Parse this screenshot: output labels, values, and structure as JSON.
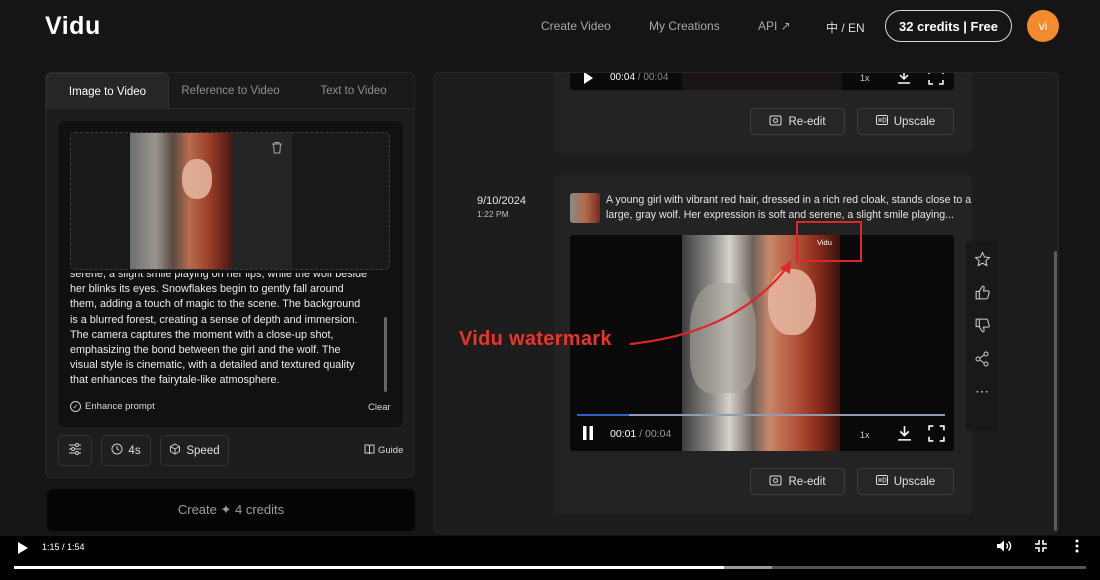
{
  "header": {
    "logo": "Vidu",
    "nav": [
      "Create Video",
      "My Creations",
      "API ↗"
    ],
    "lang": "中 / EN",
    "credits": "32 credits | Free",
    "avatar": "vi"
  },
  "left": {
    "tabs": [
      "Image to Video",
      "Reference to Video",
      "Text to Video"
    ],
    "active_tab": "Image to Video",
    "prompt": "serene, a slight smile playing on her lips, while the wolf beside her blinks its eyes. Snowflakes begin to gently fall around them, adding a touch of magic to the scene. The background is a blurred forest, creating a sense of depth and immersion. The camera captures the moment with a close-up shot, emphasizing the bond between the girl and the wolf. The visual style is cinematic, with a detailed and textured quality that enhances the fairytale-like atmosphere.",
    "enhance_label": "Enhance prompt",
    "clear_label": "Clear",
    "duration_label": "4s",
    "speed_label": "Speed",
    "guide_label": "Guide",
    "create_label": "Create ✦ 4 credits"
  },
  "right": {
    "top_video": {
      "current": "00:04",
      "total": "00:04",
      "speed": "1x"
    },
    "reedit_label": "Re-edit",
    "upscale_label": "Upscale",
    "entry": {
      "date": "9/10/2024",
      "time": "1:22 PM",
      "description": "A young girl with vibrant red hair, dressed in a rich red cloak, stands close to a large, gray wolf. Her expression is soft and serene, a slight smile playing...",
      "video": {
        "current": "00:01",
        "total": "00:04",
        "speed": "1x",
        "progress": 0.14,
        "watermark": "Vidu"
      }
    }
  },
  "annotation": {
    "text": "Vidu watermark",
    "color": "#e8352e"
  },
  "player": {
    "time": "1:15 / 1:54",
    "progress": 0.662,
    "buffered": 0.707
  },
  "colors": {
    "accent_orange": "#f28a2e",
    "progress_blue": "#2f5fc7"
  }
}
